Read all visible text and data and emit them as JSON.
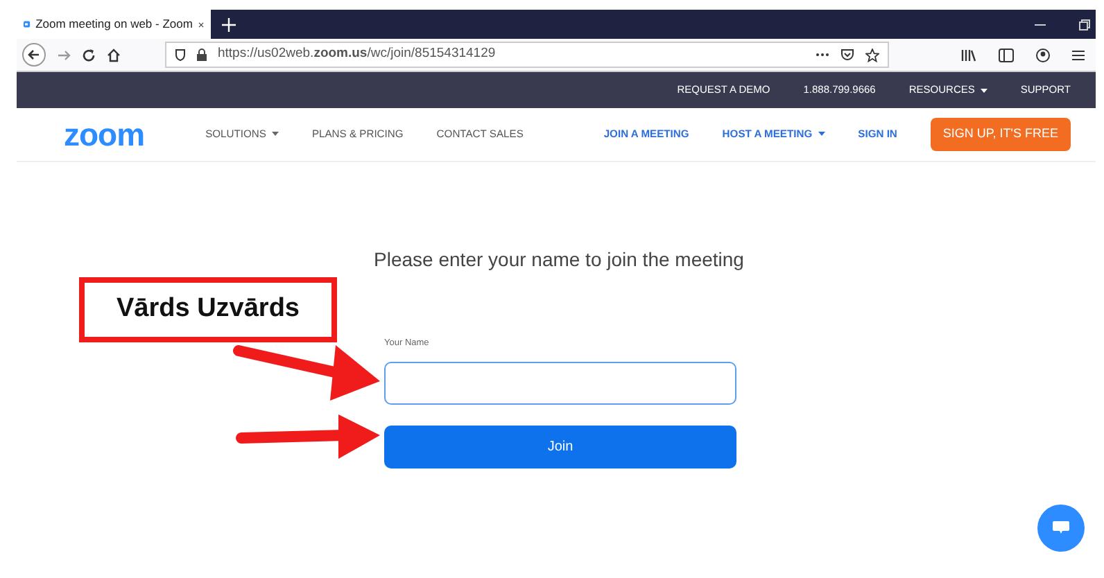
{
  "browser": {
    "tab_title": "Zoom meeting on web - Zoom",
    "url": "https://us02web.**zoom.us**/wc/join/85154314129"
  },
  "top_bar": [
    {
      "label": "REQUEST A DEMO",
      "has_menu": false
    },
    {
      "label": "1.888.799.9666",
      "has_menu": false
    },
    {
      "label": "RESOURCES",
      "has_menu": true
    },
    {
      "label": "SUPPORT",
      "has_menu": false
    }
  ],
  "nav_left": [
    {
      "label": "SOLUTIONS",
      "has_menu": true
    },
    {
      "label": "PLANS & PRICING",
      "has_menu": false
    },
    {
      "label": "CONTACT SALES",
      "has_menu": false
    }
  ],
  "nav_right": [
    {
      "label": "JOIN A MEETING",
      "has_menu": false
    },
    {
      "label": "HOST A MEETING",
      "has_menu": true
    },
    {
      "label": "SIGN IN",
      "has_menu": false
    }
  ],
  "logo": "zoom",
  "signup_button": "SIGN UP, IT'S FREE",
  "form": {
    "heading": "Please enter your name to join the meeting",
    "name_label": "Your Name",
    "join_button": "Join"
  },
  "annotation": {
    "text": "Vārds Uzvārds"
  }
}
